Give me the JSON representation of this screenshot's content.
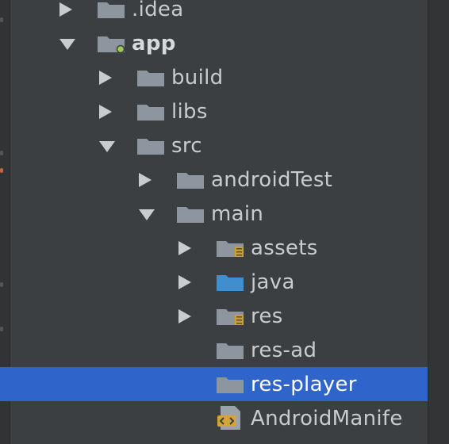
{
  "tree": {
    "items": [
      {
        "label": ".idea",
        "state": "collapsed",
        "depth": 0,
        "icon": "folder-icon"
      },
      {
        "label": "app",
        "state": "expanded",
        "depth": 0,
        "icon": "module-folder-icon",
        "bold": true
      },
      {
        "label": "build",
        "state": "collapsed",
        "depth": 1,
        "icon": "folder-icon"
      },
      {
        "label": "libs",
        "state": "collapsed",
        "depth": 1,
        "icon": "folder-icon"
      },
      {
        "label": "src",
        "state": "expanded",
        "depth": 1,
        "icon": "folder-icon"
      },
      {
        "label": "androidTest",
        "state": "collapsed",
        "depth": 2,
        "icon": "folder-icon"
      },
      {
        "label": "main",
        "state": "expanded",
        "depth": 2,
        "icon": "folder-icon"
      },
      {
        "label": "assets",
        "state": "collapsed",
        "depth": 3,
        "icon": "resource-folder-icon"
      },
      {
        "label": "java",
        "state": "collapsed",
        "depth": 3,
        "icon": "source-folder-icon"
      },
      {
        "label": "res",
        "state": "collapsed",
        "depth": 3,
        "icon": "resource-folder-icon"
      },
      {
        "label": "res-ad",
        "state": "none",
        "depth": 3,
        "icon": "folder-icon"
      },
      {
        "label": "res-player",
        "state": "none",
        "depth": 3,
        "icon": "folder-icon",
        "selected": true
      },
      {
        "label": "AndroidManife",
        "state": "none",
        "depth": 3,
        "icon": "manifest-file-icon"
      }
    ]
  },
  "colors": {
    "background": "#3c3f41",
    "selection": "#2f65ca",
    "folder": "#8d969e",
    "source_folder": "#3f8fd0",
    "resource_badge": "#c7a039",
    "module_dot": "#9fc94f",
    "text": "#c9ccce"
  }
}
